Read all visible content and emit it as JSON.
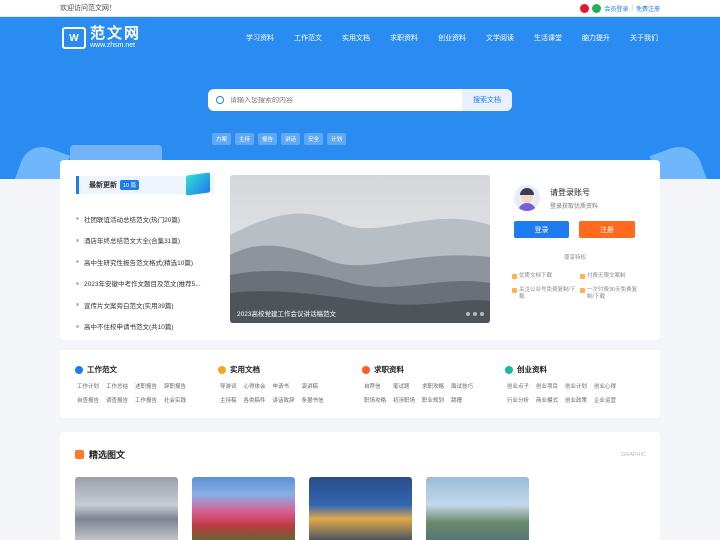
{
  "topbar": {
    "welcome": "欢迎访问范文网！",
    "member_login": "会员登录",
    "separator": "|",
    "free_register": "免费注册"
  },
  "logo": {
    "cn": "范文网",
    "en": "www.zhsm.net",
    "mark": "W"
  },
  "nav": [
    "学习资料",
    "工作范文",
    "实用文档",
    "求职资料",
    "创业资料",
    "文学阅读",
    "生活课堂",
    "脑力提升",
    "关于我们"
  ],
  "search": {
    "placeholder": "请输入您搜索的内容",
    "button": "搜索文档",
    "tags": [
      "方案",
      "主持",
      "报告",
      "讲话",
      "安全",
      "计划"
    ]
  },
  "latest": {
    "title": "最新更新",
    "count": "10 篇",
    "items": [
      "社团联谊活动总结范文(热门20篇)",
      "酒店年终总结范文大全(合集31篇)",
      "高中生研究性报告范文格式(精选10篇)",
      "2023年安徽中考作文题目及范文(推荐5...",
      "宣传片文案旁白范文(实用39篇)",
      "高中不住校申请书范文(共10篇)"
    ]
  },
  "carousel": {
    "caption": "2023高校党建工作会议讲话稿范文"
  },
  "login_panel": {
    "title": "请登录账号",
    "subtitle": "登录获取优质资料",
    "login_button": "登录",
    "register_button": "注册",
    "privilege_title": "尊享特权",
    "perks": [
      "优质文档下载",
      "付费无限文案制",
      "关注公众号免费复制/下载",
      "一次付费30天免费复制/下载"
    ]
  },
  "categories": [
    {
      "title": "工作范文",
      "color": "#1e7cf0",
      "links": [
        "工作计划",
        "工作总结",
        "述职报告",
        "辞职报告",
        "自查报告",
        "调查报告",
        "工作报告",
        "社会实践"
      ]
    },
    {
      "title": "实用文档",
      "color": "#f5a623",
      "links": [
        "导游词",
        "心得体会",
        "申请书",
        "演讲稿",
        "主持稿",
        "各类稿件",
        "讲话致辞",
        "条据书信"
      ]
    },
    {
      "title": "求职资料",
      "color": "#ff5a1f",
      "links": [
        "自荐信",
        "笔试题",
        "求职攻略",
        "面试技巧",
        "职场攻略",
        "初涉职场",
        "职业规划",
        "跳槽"
      ]
    },
    {
      "title": "创业资料",
      "color": "#18b7a7",
      "links": [
        "创业点子",
        "创业项目",
        "创业计划",
        "创业心得",
        "行业分析",
        "商业模式",
        "创业政策",
        "企业运营"
      ]
    }
  ],
  "picks": {
    "title": "精选图文",
    "en_label": "GRAPHIC"
  },
  "colors": {
    "primary": "#1e7cf0",
    "hero": "#2a8cf1",
    "register": "#ff6a1f"
  }
}
